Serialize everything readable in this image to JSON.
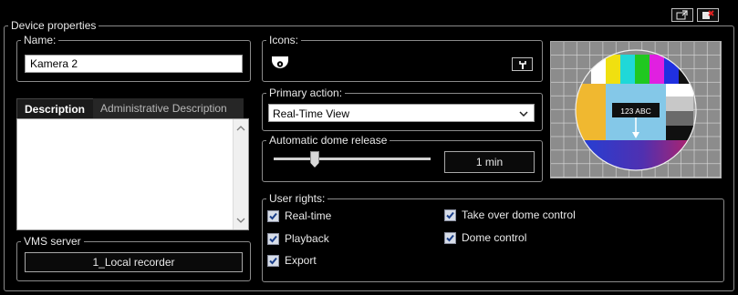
{
  "window_buttons": {
    "detach_icon": "detach-icon",
    "close_icon": "close-icon"
  },
  "device_properties": {
    "title": "Device properties",
    "name": {
      "label": "Name:",
      "value": "Kamera 2"
    },
    "tabs": [
      {
        "label": "Description",
        "active": true
      },
      {
        "label": "Administrative Description",
        "active": false
      }
    ],
    "description_text": "",
    "vms_server": {
      "label": "VMS server",
      "value": "1_Local recorder"
    },
    "icons": {
      "label": "Icons:",
      "icon": "dome-camera-icon",
      "picker_icon": "pick-icon"
    },
    "primary_action": {
      "label": "Primary action:",
      "selected": "Real-Time View"
    },
    "dome_release": {
      "label": "Automatic dome release",
      "value": "1 min",
      "slider_fraction": 0.32
    },
    "preview": {
      "caption": "123 ABC"
    },
    "user_rights": {
      "label": "User rights:",
      "items": [
        {
          "label": "Real-time",
          "checked": true
        },
        {
          "label": "Playback",
          "checked": true
        },
        {
          "label": "Export",
          "checked": true
        },
        {
          "label": "Take over dome control",
          "checked": true
        },
        {
          "label": "Dome control",
          "checked": true
        }
      ]
    }
  }
}
